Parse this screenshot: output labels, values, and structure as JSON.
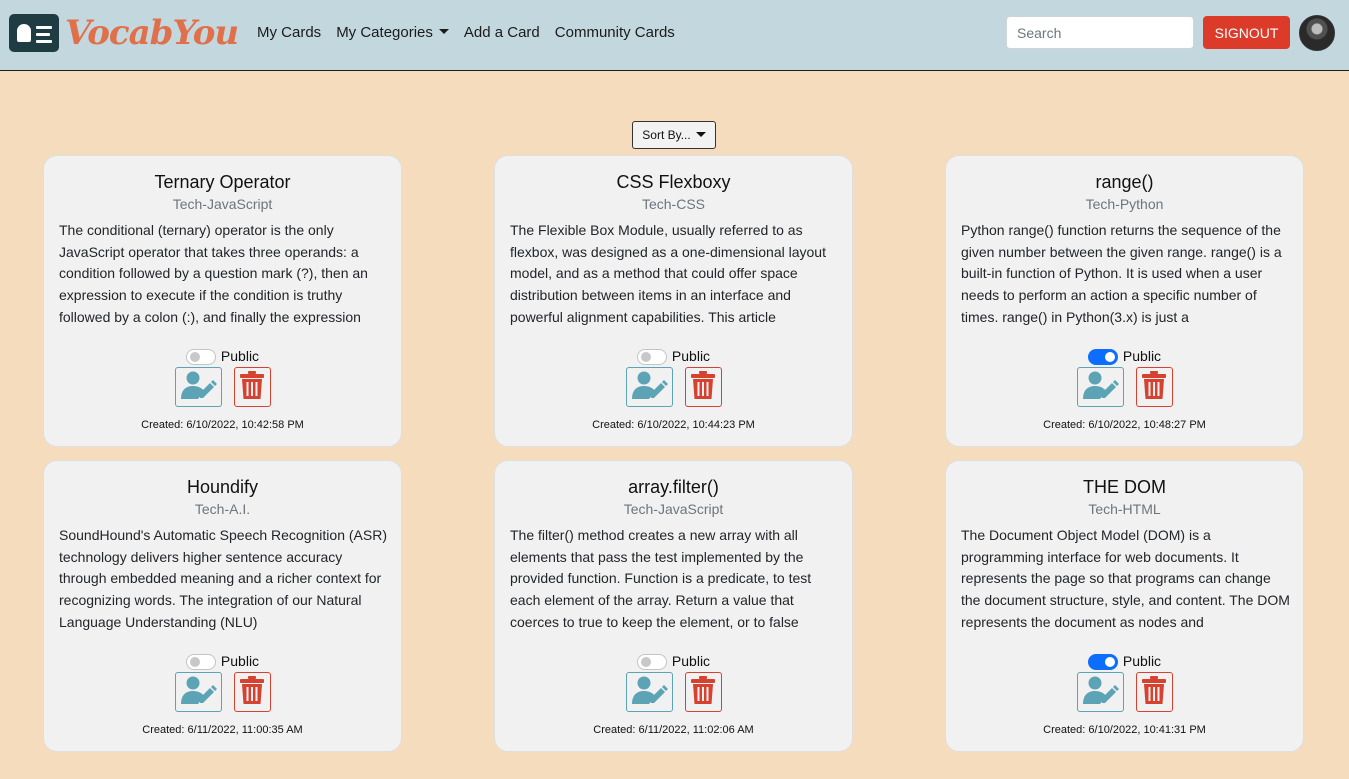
{
  "brand": {
    "name": "VocabYou",
    "icon": "id-card-icon"
  },
  "nav": {
    "my_cards": "My Cards",
    "my_categories": "My Categories",
    "add_card": "Add a Card",
    "community": "Community Cards"
  },
  "search": {
    "placeholder": "Search",
    "value": ""
  },
  "signout": "SIGNOUT",
  "sort": {
    "label": "Sort By..."
  },
  "colors": {
    "page_bg": "#f5dcbd",
    "navbar_bg": "#c3d7df",
    "brand": "#e0704a",
    "signout": "#dd3b2a",
    "edit": "#5ba3b5",
    "delete": "#d7412f",
    "toggle_on": "#0d6efd"
  },
  "cards": [
    {
      "title": "Ternary Operator",
      "category": "Tech-JavaScript",
      "body": "The conditional (ternary) operator is the only JavaScript operator that takes three operands: a condition followed by a question mark (?), then an expression to execute if the condition is truthy followed by a colon (:), and finally the expression",
      "public_label": "Public",
      "public": false,
      "created": "Created: 6/10/2022, 10:42:58 PM"
    },
    {
      "title": "CSS Flexboxy",
      "category": "Tech-CSS",
      "body": "The Flexible Box Module, usually referred to as flexbox, was designed as a one-dimensional layout model, and as a method that could offer space distribution between items in an interface and powerful alignment capabilities. This article",
      "public_label": "Public",
      "public": false,
      "created": "Created: 6/10/2022, 10:44:23 PM"
    },
    {
      "title": "range()",
      "category": "Tech-Python",
      "body": "Python range() function returns the sequence of the given number between the given range. range() is a built-in function of Python. It is used when a user needs to perform an action a specific number of times. range() in Python(3.x) is just a",
      "public_label": "Public",
      "public": true,
      "created": "Created: 6/10/2022, 10:48:27 PM"
    },
    {
      "title": "Houndify",
      "category": "Tech-A.I.",
      "body": "SoundHound's Automatic Speech Recognition (ASR) technology delivers higher sentence accuracy through embedded meaning and a richer context for recognizing words. The integration of our Natural Language Understanding (NLU)",
      "public_label": "Public",
      "public": false,
      "created": "Created: 6/11/2022, 11:00:35 AM"
    },
    {
      "title": "array.filter()",
      "category": "Tech-JavaScript",
      "body": "The filter() method creates a new array with all elements that pass the test implemented by the provided function. Function is a predicate, to test each element of the array. Return a value that coerces to true to keep the element, or to false",
      "public_label": "Public",
      "public": false,
      "created": "Created: 6/11/2022, 11:02:06 AM"
    },
    {
      "title": "THE DOM",
      "category": "Tech-HTML",
      "body": "The Document Object Model (DOM) is a programming interface for web documents. It represents the page so that programs can change the document structure, style, and content. The DOM represents the document as nodes and",
      "public_label": "Public",
      "public": true,
      "created": "Created: 6/10/2022, 10:41:31 PM"
    }
  ]
}
